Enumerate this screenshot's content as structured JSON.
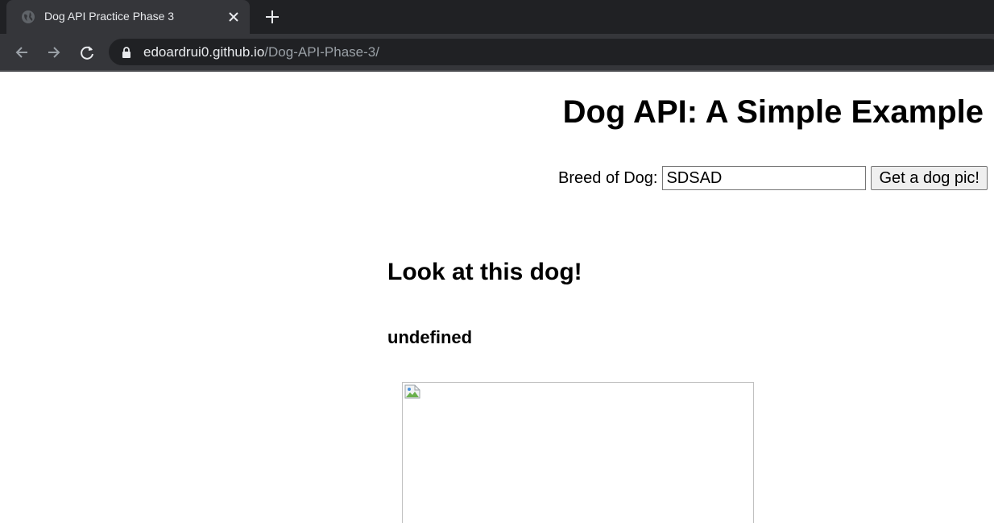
{
  "browser": {
    "tab_title": "Dog API Practice Phase 3",
    "url_domain": "edoardrui0.github.io",
    "url_path": "/Dog-API-Phase-3/",
    "icons": [
      "globe-icon",
      "close-icon",
      "plus-icon",
      "back-icon",
      "forward-icon",
      "reload-icon",
      "lock-icon"
    ]
  },
  "page": {
    "heading": "Dog API: A Simple Example",
    "form": {
      "label": "Breed of Dog:",
      "input_value": "SDSAD",
      "button_label": "Get a dog pic!"
    },
    "result_heading": "Look at this dog!",
    "result_subheading": "undefined",
    "image_icon": "broken-image-icon"
  }
}
